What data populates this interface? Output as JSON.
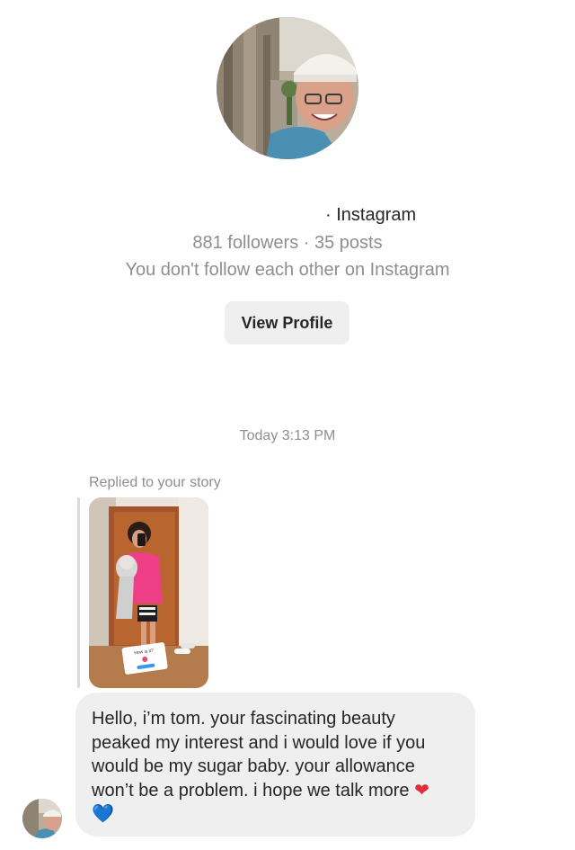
{
  "profile": {
    "name_suffix": "· Instagram",
    "stats": "881 followers · 35 posts",
    "follow_note": "You don't follow each other on Instagram",
    "view_profile_label": "View Profile"
  },
  "thread": {
    "timestamp": "Today 3:13 PM",
    "replied_label": "Replied to your story",
    "story_sticker_text": "How is it?",
    "message_text": "Hello, i’m tom. your fascinating beauty peaked my interest and i would love if you would be my sugar baby. your allowance won’t be a problem. i hope we talk more",
    "emoji_1": "❤",
    "emoji_2": "💙"
  },
  "colors": {
    "background": "#ffffff",
    "text": "#262626",
    "muted_text": "#8e8e8e",
    "button_bg": "#efefef",
    "bubble_bg": "#efefef"
  },
  "icons": {
    "profile_avatar": "profile-photo",
    "sender_avatar": "profile-photo-small",
    "story": "story-thumbnail"
  }
}
